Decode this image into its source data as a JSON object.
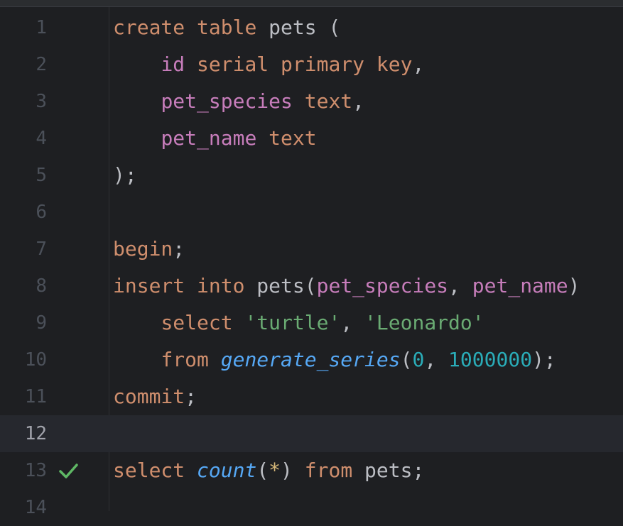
{
  "editor": {
    "current_line": 12,
    "status_line": 13,
    "lines": [
      {
        "n": "1",
        "tokens": [
          [
            "kw",
            "create"
          ],
          [
            "plain",
            " "
          ],
          [
            "kw",
            "table"
          ],
          [
            "plain",
            " pets ("
          ]
        ]
      },
      {
        "n": "2",
        "tokens": [
          [
            "plain",
            "    "
          ],
          [
            "col",
            "id"
          ],
          [
            "plain",
            " "
          ],
          [
            "kw",
            "serial primary key"
          ],
          [
            "plain",
            ","
          ]
        ]
      },
      {
        "n": "3",
        "tokens": [
          [
            "plain",
            "    "
          ],
          [
            "col",
            "pet_species"
          ],
          [
            "plain",
            " "
          ],
          [
            "kw",
            "text"
          ],
          [
            "plain",
            ","
          ]
        ]
      },
      {
        "n": "4",
        "tokens": [
          [
            "plain",
            "    "
          ],
          [
            "col",
            "pet_name"
          ],
          [
            "plain",
            " "
          ],
          [
            "kw",
            "text"
          ]
        ]
      },
      {
        "n": "5",
        "tokens": [
          [
            "plain",
            ");"
          ]
        ]
      },
      {
        "n": "6",
        "tokens": []
      },
      {
        "n": "7",
        "tokens": [
          [
            "kw",
            "begin"
          ],
          [
            "plain",
            ";"
          ]
        ]
      },
      {
        "n": "8",
        "tokens": [
          [
            "kw",
            "insert"
          ],
          [
            "plain",
            " "
          ],
          [
            "kw",
            "into"
          ],
          [
            "plain",
            " pets("
          ],
          [
            "col",
            "pet_species"
          ],
          [
            "plain",
            ", "
          ],
          [
            "col",
            "pet_name"
          ],
          [
            "plain",
            ")"
          ]
        ]
      },
      {
        "n": "9",
        "tokens": [
          [
            "plain",
            "    "
          ],
          [
            "kw",
            "select"
          ],
          [
            "plain",
            " "
          ],
          [
            "str",
            "'turtle'"
          ],
          [
            "plain",
            ", "
          ],
          [
            "str",
            "'Leonardo'"
          ]
        ]
      },
      {
        "n": "10",
        "tokens": [
          [
            "plain",
            "    "
          ],
          [
            "kw",
            "from"
          ],
          [
            "plain",
            " "
          ],
          [
            "fn",
            "generate_series"
          ],
          [
            "plain",
            "("
          ],
          [
            "num",
            "0"
          ],
          [
            "plain",
            ", "
          ],
          [
            "num",
            "1000000"
          ],
          [
            "plain",
            ");"
          ]
        ]
      },
      {
        "n": "11",
        "tokens": [
          [
            "kw",
            "commit"
          ],
          [
            "plain",
            ";"
          ]
        ]
      },
      {
        "n": "12",
        "tokens": []
      },
      {
        "n": "13",
        "tokens": [
          [
            "kw",
            "select"
          ],
          [
            "plain",
            " "
          ],
          [
            "fn",
            "count"
          ],
          [
            "plain",
            "("
          ],
          [
            "star",
            "*"
          ],
          [
            "plain",
            ") "
          ],
          [
            "kw",
            "from"
          ],
          [
            "plain",
            " pets;"
          ]
        ]
      },
      {
        "n": "14",
        "tokens": []
      }
    ]
  },
  "icons": {
    "status": "checkmark-icon"
  },
  "colors": {
    "background": "#1e1f22",
    "keyword": "#cf8e6d",
    "column": "#c77dbb",
    "string": "#6aab73",
    "number": "#2aacb8",
    "function": "#56a8f5",
    "success": "#5fb865"
  }
}
